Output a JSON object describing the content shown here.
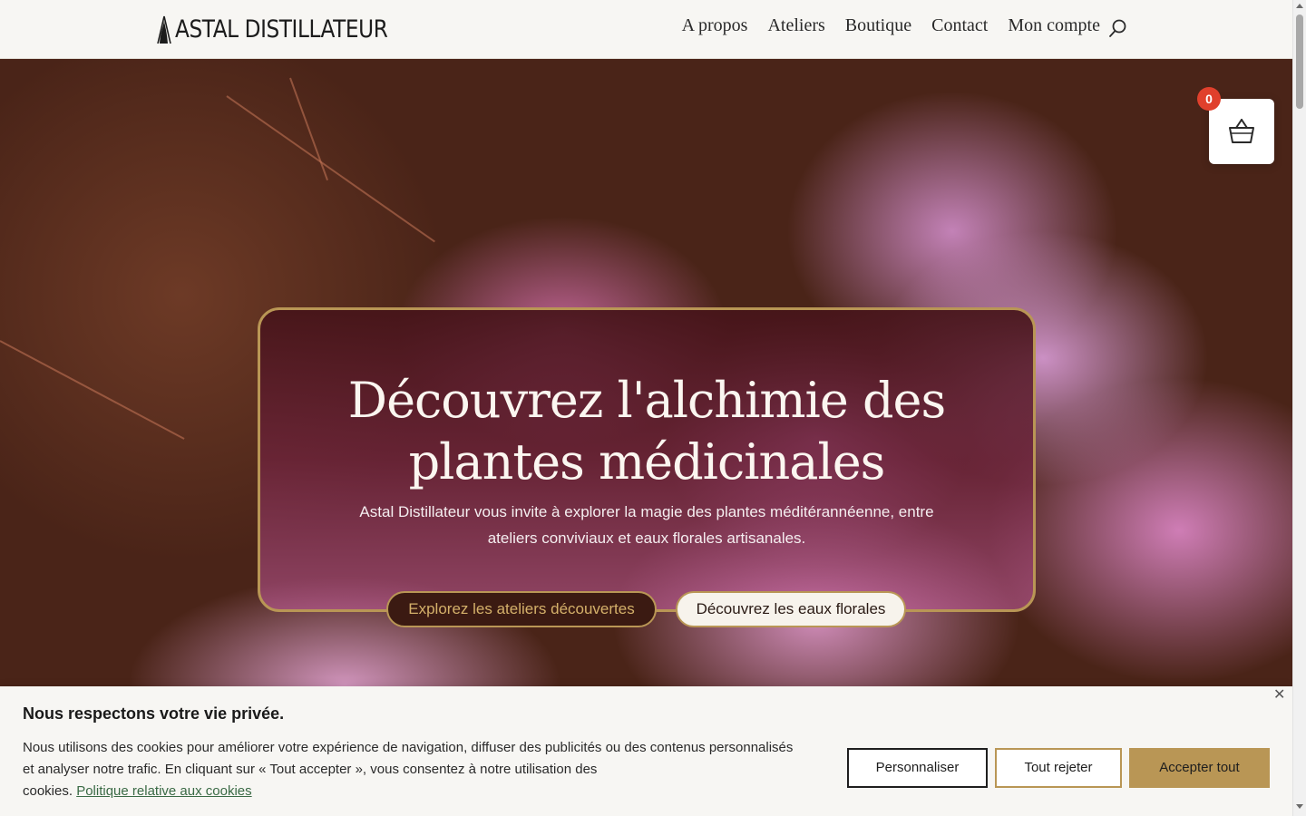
{
  "header": {
    "logo_text": "ASTAL DISTILLATEUR",
    "nav": [
      "A propos",
      "Ateliers",
      "Boutique",
      "Contact",
      "Mon compte"
    ]
  },
  "hero": {
    "title_line1": "Découvrez l'alchimie des",
    "title_line2": "plantes médicinales",
    "subtitle_line1": "Astal Distillateur vous invite à explorer la magie des plantes méditérannéenne, entre",
    "subtitle_line2": "ateliers conviviaux et eaux florales artisanales.",
    "primary_button": "Explorez les ateliers découvertes",
    "secondary_button": "Découvrez les eaux florales"
  },
  "cart": {
    "count": "0"
  },
  "cookie_banner": {
    "title": "Nous respectons votre vie privée.",
    "text_line1": "Nous utilisons des cookies pour améliorer votre expérience de navigation, diffuser des publicités ou des contenus personnalisés",
    "text_line2": "et analyser notre trafic. En cliquant sur « Tout accepter », vous consentez à notre utilisation des",
    "text_line3": "cookies.",
    "policy_link": "Politique relative aux cookies",
    "customize": "Personnaliser",
    "reject": "Tout rejeter",
    "accept": "Accepter tout"
  },
  "colors": {
    "gold_accent": "#b99655",
    "badge_red": "#e0402c",
    "background": "#f7f6f3"
  }
}
